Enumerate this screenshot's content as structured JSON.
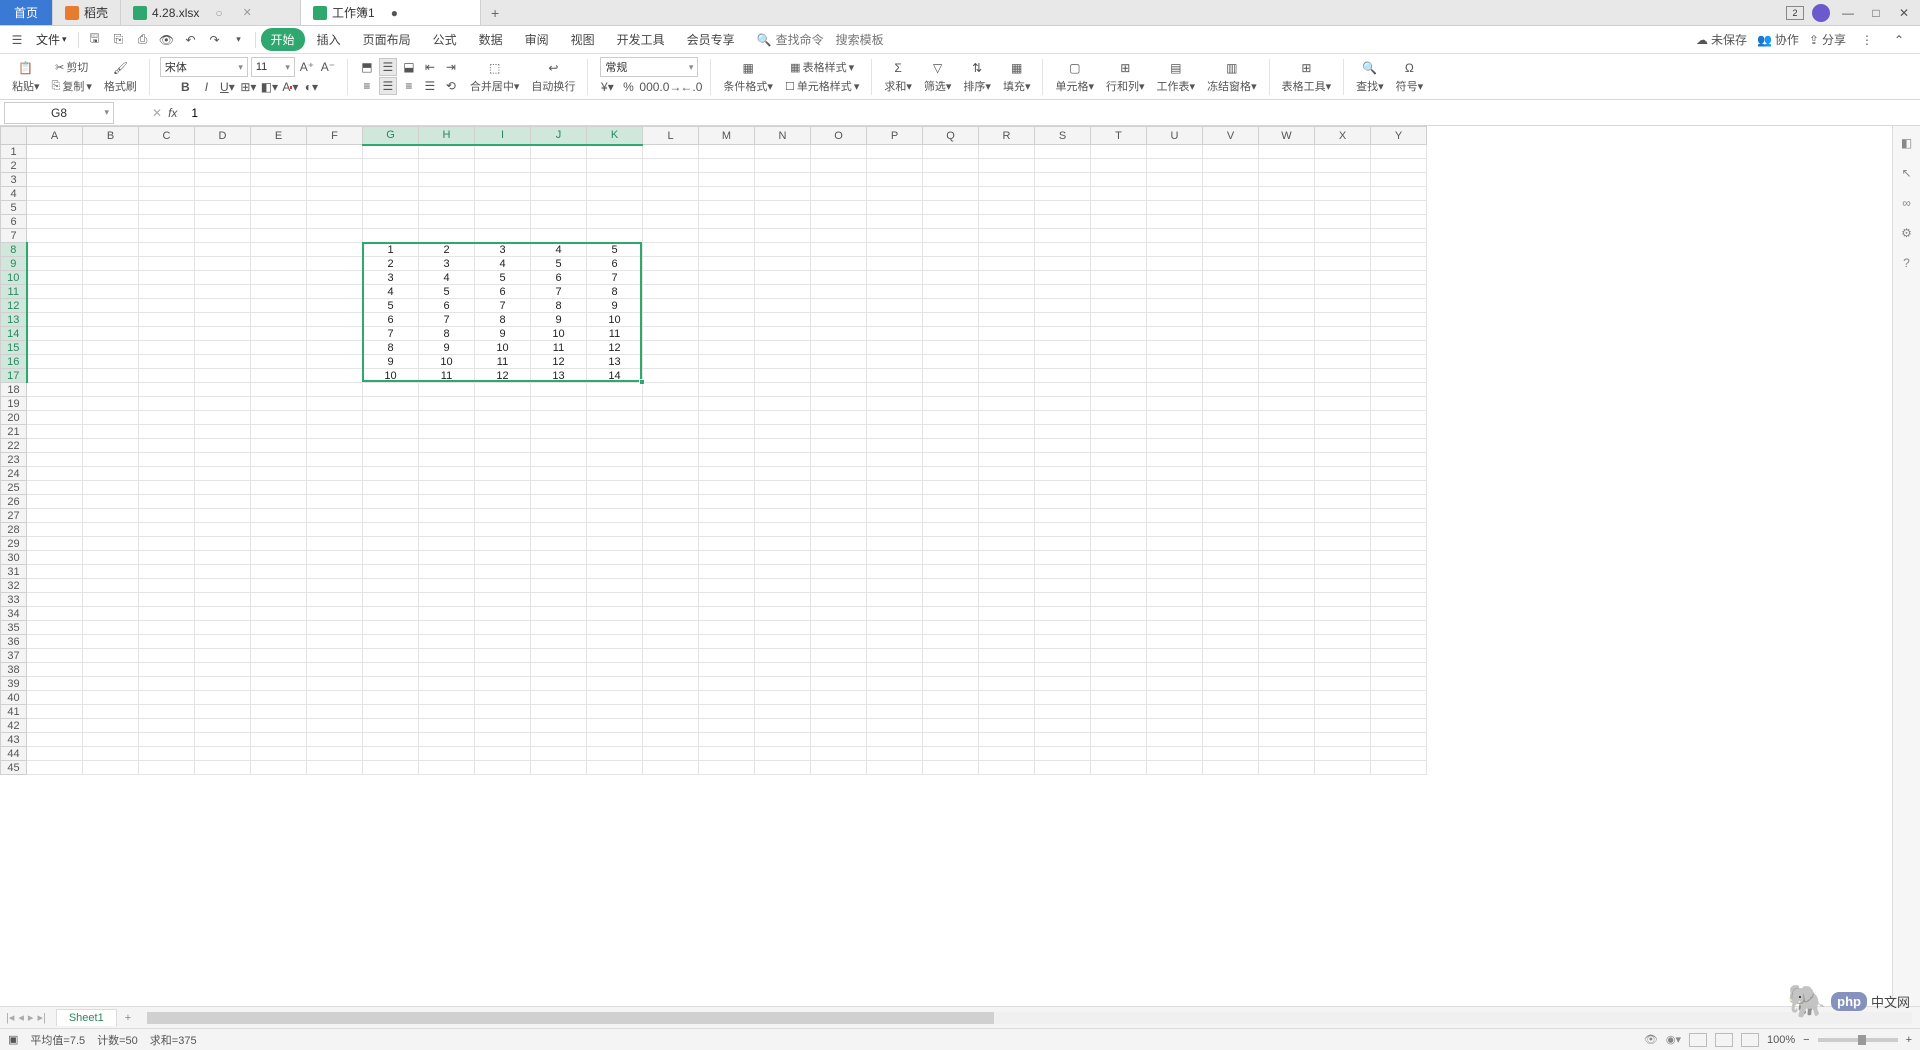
{
  "titlebar": {
    "home": "首页",
    "tabs": [
      {
        "label": "稻壳",
        "icon": "orange"
      },
      {
        "label": "4.28.xlsx",
        "icon": "green",
        "modified": "○"
      },
      {
        "label": "工作簿1",
        "icon": "green",
        "modified": "●",
        "active": true
      }
    ],
    "add": "+",
    "badge": "2"
  },
  "menubar": {
    "file": "文件",
    "tabs": [
      "开始",
      "插入",
      "页面布局",
      "公式",
      "数据",
      "审阅",
      "视图",
      "开发工具",
      "会员专享"
    ],
    "search_ph": "查找命令",
    "search_tpl": "搜索模板",
    "unsaved": "未保存",
    "collab": "协作",
    "share": "分享"
  },
  "ribbon": {
    "paste": "粘贴",
    "cut": "剪切",
    "copy": "复制",
    "format_painter": "格式刷",
    "font": "宋体",
    "size": "11",
    "number_format": "常规",
    "merge": "合并居中",
    "wrap": "自动换行",
    "cond_format": "条件格式",
    "table_style": "表格样式",
    "cell_style": "单元格样式",
    "sum": "求和",
    "filter": "筛选",
    "sort": "排序",
    "fill": "填充",
    "cell": "单元格",
    "rowcol": "行和列",
    "worksheet": "工作表",
    "freeze": "冻结窗格",
    "table_tools": "表格工具",
    "find": "查找",
    "symbol": "符号"
  },
  "formula": {
    "cellref": "G8",
    "value": "1"
  },
  "columns": [
    "A",
    "B",
    "C",
    "D",
    "E",
    "F",
    "G",
    "H",
    "I",
    "J",
    "K",
    "L",
    "M",
    "N",
    "O",
    "P",
    "Q",
    "R",
    "S",
    "T",
    "U",
    "V",
    "W",
    "X",
    "Y"
  ],
  "sel_cols": [
    "G",
    "H",
    "I",
    "J",
    "K"
  ],
  "sel_rows": [
    8,
    9,
    10,
    11,
    12,
    13,
    14,
    15,
    16,
    17
  ],
  "row_count": 45,
  "cells": {
    "G8": "1",
    "H8": "2",
    "I8": "3",
    "J8": "4",
    "K8": "5",
    "G9": "2",
    "H9": "3",
    "I9": "4",
    "J9": "5",
    "K9": "6",
    "G10": "3",
    "H10": "4",
    "I10": "5",
    "J10": "6",
    "K10": "7",
    "G11": "4",
    "H11": "5",
    "I11": "6",
    "J11": "7",
    "K11": "8",
    "G12": "5",
    "H12": "6",
    "I12": "7",
    "J12": "8",
    "K12": "9",
    "G13": "6",
    "H13": "7",
    "I13": "8",
    "J13": "9",
    "K13": "10",
    "G14": "7",
    "H14": "8",
    "I14": "9",
    "J14": "10",
    "K14": "11",
    "G15": "8",
    "H15": "9",
    "I15": "10",
    "J15": "11",
    "K15": "12",
    "G16": "9",
    "H16": "10",
    "I16": "11",
    "J16": "12",
    "K16": "13",
    "G17": "10",
    "H17": "11",
    "I17": "12",
    "J17": "13",
    "K17": "14"
  },
  "sheettabs": {
    "sheet1": "Sheet1",
    "add": "+"
  },
  "status": {
    "avg": "平均值=7.5",
    "count": "计数=50",
    "sum": "求和=375",
    "zoom": "100%"
  },
  "watermark": {
    "php": "php",
    "txt": "中文网"
  }
}
